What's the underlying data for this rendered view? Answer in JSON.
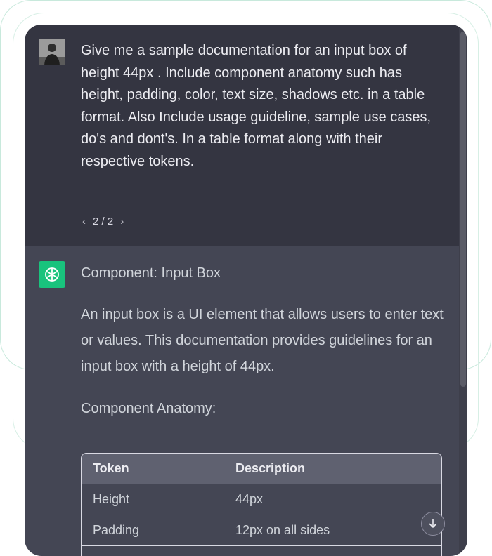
{
  "conversation": {
    "user_message": {
      "text": "Give me a sample documentation for an input box of height 44px . Include component anatomy such has height, padding, color, text size, shadows etc. in a table format. Also  Include usage guideline, sample use cases, do's and dont's. In a table format along with their respective tokens.",
      "pager": "2 / 2"
    },
    "assistant_message": {
      "title": "Component: Input Box",
      "paragraph": "An input box is a UI element that allows users to enter text or values. This documentation provides guidelines for an input box with a height of 44px.",
      "subtitle": "Component Anatomy:",
      "table": {
        "headers": [
          "Token",
          "Description"
        ],
        "rows": [
          [
            "Height",
            "44px"
          ],
          [
            "Padding",
            "12px on all sides"
          ],
          [
            "",
            ""
          ]
        ]
      }
    }
  },
  "icons": {
    "prev": "chevron-left-icon",
    "next": "chevron-right-icon",
    "assistant": "openai-logo-icon",
    "scroll": "arrow-down-icon"
  },
  "colors": {
    "user_bg": "#343541",
    "assistant_bg": "#444654",
    "logo_bg": "#19c37d"
  }
}
